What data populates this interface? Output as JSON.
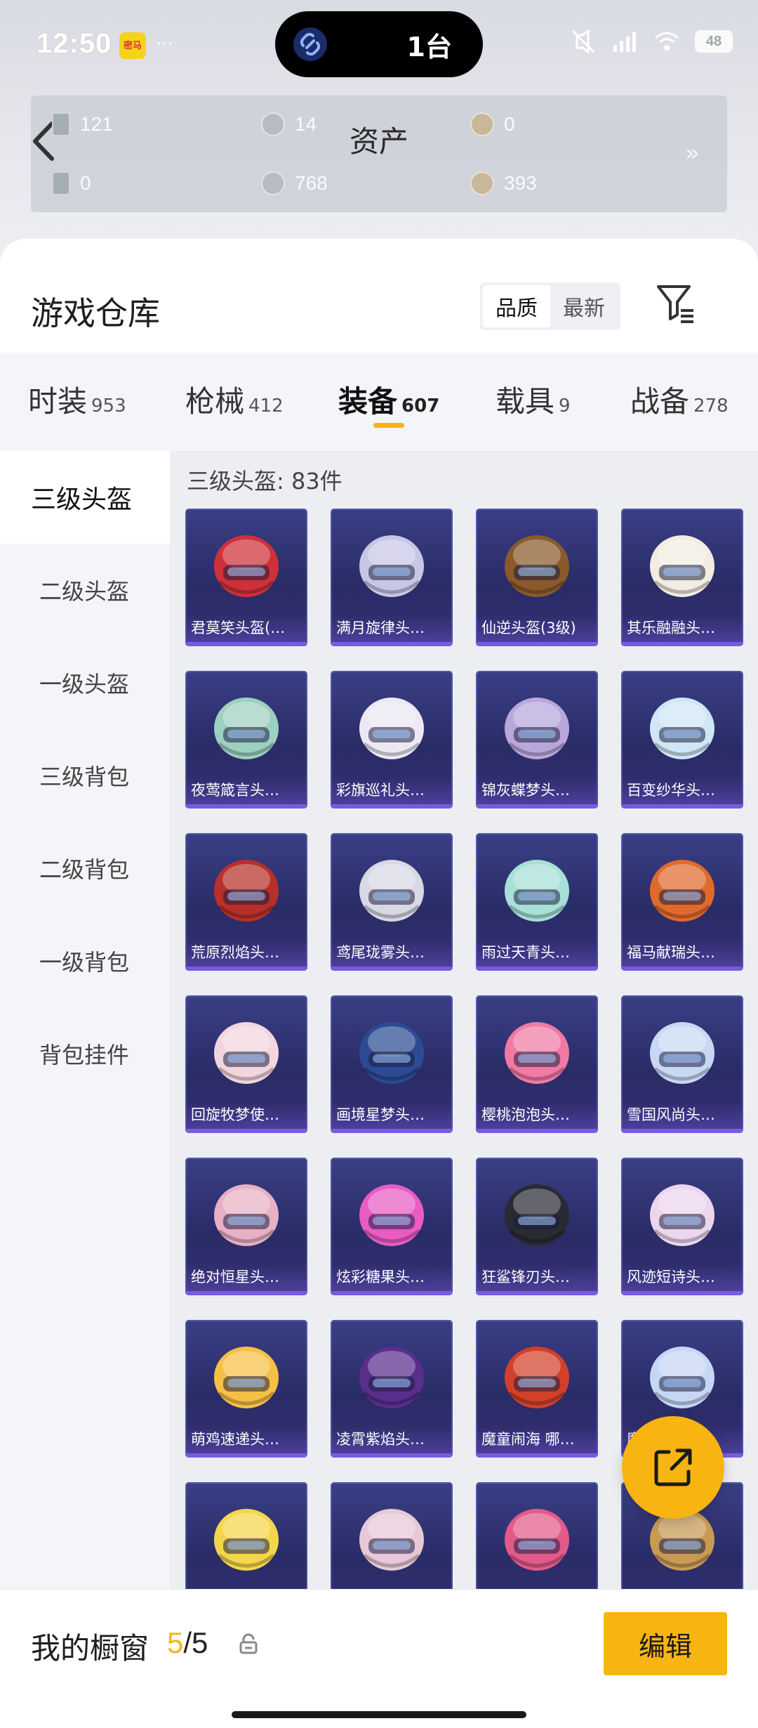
{
  "status_bar": {
    "time": "12:50",
    "app_badge": "密马",
    "dots": "···",
    "island_text": "1台",
    "battery": "48"
  },
  "header": {
    "back_icon": "chevron-left-icon",
    "title": "资产",
    "assets": [
      {
        "icon": "card-icon",
        "value": "121"
      },
      {
        "icon": "coin-icon",
        "value": "14"
      },
      {
        "icon": "gold-coin-icon",
        "value": "0"
      },
      {
        "icon": "card-icon",
        "value": "0"
      },
      {
        "icon": "coin-icon",
        "value": "768"
      },
      {
        "icon": "gold-coin-icon",
        "value": "393"
      }
    ],
    "more_glyph": "»"
  },
  "warehouse": {
    "title": "游戏仓库",
    "sort_options": [
      "品质",
      "最新"
    ],
    "sort_selected": "品质",
    "filter_icon": "filter-icon"
  },
  "tabs": [
    {
      "label": "时装",
      "count": "953"
    },
    {
      "label": "枪械",
      "count": "412"
    },
    {
      "label": "装备",
      "count": "607"
    },
    {
      "label": "载具",
      "count": "9"
    },
    {
      "label": "战备",
      "count": "278"
    }
  ],
  "active_tab": "装备",
  "categories": [
    "三级头盔",
    "二级头盔",
    "一级头盔",
    "三级背包",
    "二级背包",
    "一级背包",
    "背包挂件"
  ],
  "active_category": "三级头盔",
  "grid": {
    "count_label": "三级头盔: 83件",
    "items": [
      {
        "name": "君莫笑头盔(…",
        "color": "#d0303a"
      },
      {
        "name": "满月旋律头…",
        "color": "#c8c6e6"
      },
      {
        "name": "仙逆头盔(3级)",
        "color": "#8a5a2c"
      },
      {
        "name": "其乐融融头…",
        "color": "#f2ede2"
      },
      {
        "name": "夜莺箴言头…",
        "color": "#9ed0c0"
      },
      {
        "name": "彩旗巡礼头…",
        "color": "#ece8f6"
      },
      {
        "name": "锦灰蝶梦头…",
        "color": "#b9a7dc"
      },
      {
        "name": "百变纱华头…",
        "color": "#cfe6f6"
      },
      {
        "name": "荒原烈焰头…",
        "color": "#b8302a"
      },
      {
        "name": "鸢尾珑雾头…",
        "color": "#d8d8e6"
      },
      {
        "name": "雨过天青头…",
        "color": "#a6e0d6"
      },
      {
        "name": "福马献瑞头…",
        "color": "#e06a2e"
      },
      {
        "name": "回旋牧梦使…",
        "color": "#f2d6de"
      },
      {
        "name": "画境星梦头…",
        "color": "#2c4b94"
      },
      {
        "name": "樱桃泡泡头…",
        "color": "#f07aa4"
      },
      {
        "name": "雪国风尚头…",
        "color": "#c8d8f4"
      },
      {
        "name": "绝对恒星头…",
        "color": "#e8b0c4"
      },
      {
        "name": "炫彩糖果头…",
        "color": "#e85cc4"
      },
      {
        "name": "狂鲨锋刃头…",
        "color": "#2a2a34"
      },
      {
        "name": "风迹短诗头…",
        "color": "#ecd6ee"
      },
      {
        "name": "萌鸡速递头…",
        "color": "#f6c046"
      },
      {
        "name": "凌霄紫焰头…",
        "color": "#5a2e8c"
      },
      {
        "name": "魔童闹海 哪…",
        "color": "#d2402a"
      },
      {
        "name": "魔童闹海 敖…",
        "color": "#c6d6f6"
      },
      {
        "name": "",
        "color": "#f4d64a"
      },
      {
        "name": "",
        "color": "#e8c8d8"
      },
      {
        "name": "",
        "color": "#e25a8a"
      },
      {
        "name": "",
        "color": "#c89a54"
      }
    ]
  },
  "fab_icon": "share-icon",
  "bottom_bar": {
    "label": "我的橱窗",
    "current": "5",
    "separator": "/",
    "total": "5",
    "lock_icon": "lock-icon",
    "edit_label": "编辑"
  },
  "colors": {
    "accent": "#f8b410",
    "tile_top": "#3a3f86",
    "tile_bottom": "#2a2c66"
  }
}
